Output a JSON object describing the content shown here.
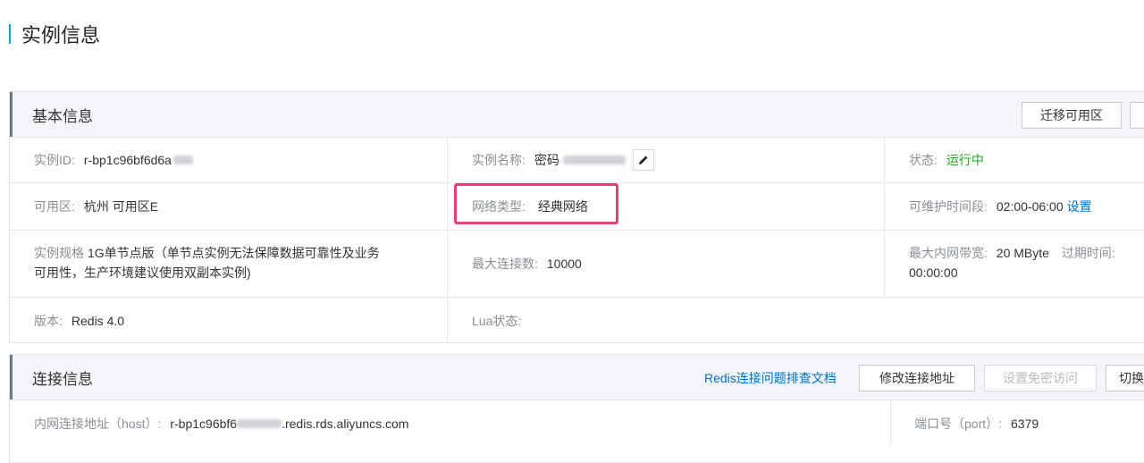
{
  "page_title": "实例信息",
  "basic": {
    "title": "基本信息",
    "buttons": {
      "migrate_zone": "迁移可用区"
    },
    "instance_id": {
      "label": "实例ID:",
      "value": "r-bp1c96bf6d6a"
    },
    "instance_name": {
      "label": "实例名称:",
      "value": "密码"
    },
    "status": {
      "label": "状态:",
      "value": "运行中"
    },
    "zone": {
      "label": "可用区:",
      "value": "杭州 可用区E"
    },
    "network_type": {
      "label": "网络类型:",
      "value": "经典网络"
    },
    "maintenance": {
      "label": "可维护时间段:",
      "value": "02:00-06:00",
      "link": "设置"
    },
    "spec": {
      "label": "实例规格",
      "value_line1": "1G单节点版（单节点实例无法保障数据可靠性及业务",
      "value_line2": "可用性，生产环境建议使用双副本实例)"
    },
    "max_conn": {
      "label": "最大连接数:",
      "value": "10000"
    },
    "bandwidth": {
      "label": "最大内网带宽:",
      "value": "20 MByte",
      "expire_label": "过期时间:",
      "expire_value": "00:00:00"
    },
    "version": {
      "label": "版本:",
      "value": "Redis 4.0"
    },
    "lua": {
      "label": "Lua状态:"
    }
  },
  "connection": {
    "title": "连接信息",
    "doc_link": "Redis连接问题排查文档",
    "buttons": {
      "modify_addr": "修改连接地址",
      "passwordless": "设置免密访问",
      "switch": "切换"
    },
    "host": {
      "label": "内网连接地址（host）:",
      "value_prefix": "r-bp1c96bf6",
      "value_suffix": ".redis.rds.aliyuncs.com"
    },
    "port": {
      "label": "端口号（port）:",
      "value": "6379"
    }
  },
  "colors": {
    "accent": "#00a2ca",
    "status_ok": "#22a822",
    "link": "#0070cc",
    "highlight": "#e83f7b"
  }
}
